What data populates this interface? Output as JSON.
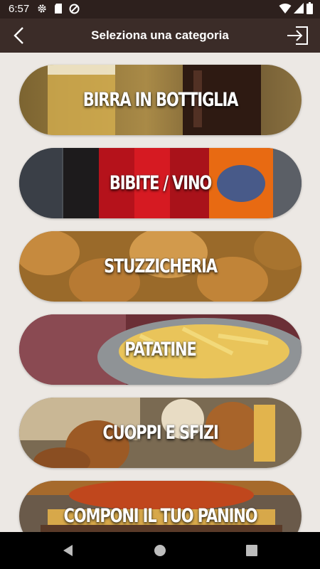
{
  "status": {
    "time": "6:57"
  },
  "header": {
    "title": "Seleziona una categoria"
  },
  "categories": [
    {
      "label": "BIRRA IN BOTTIGLIA"
    },
    {
      "label": "BIBITE / VINO"
    },
    {
      "label": "STUZZICHERIA"
    },
    {
      "label": "PATATINE"
    },
    {
      "label": "CUOPPI E SFIZI"
    },
    {
      "label": "COMPONI IL TUO PANINO"
    }
  ],
  "icons": {
    "status": [
      "gear-icon",
      "sd-card-icon",
      "no-data-saver-icon",
      "wifi-icon",
      "signal-icon",
      "battery-icon"
    ],
    "header": [
      "back-arrow-icon",
      "login-icon"
    ],
    "nav": [
      "back-triangle-icon",
      "home-circle-icon",
      "recents-square-icon"
    ]
  },
  "colors": {
    "appbar": "#3b2c28",
    "statusbar": "#2d201d",
    "background": "#ece8e4"
  }
}
